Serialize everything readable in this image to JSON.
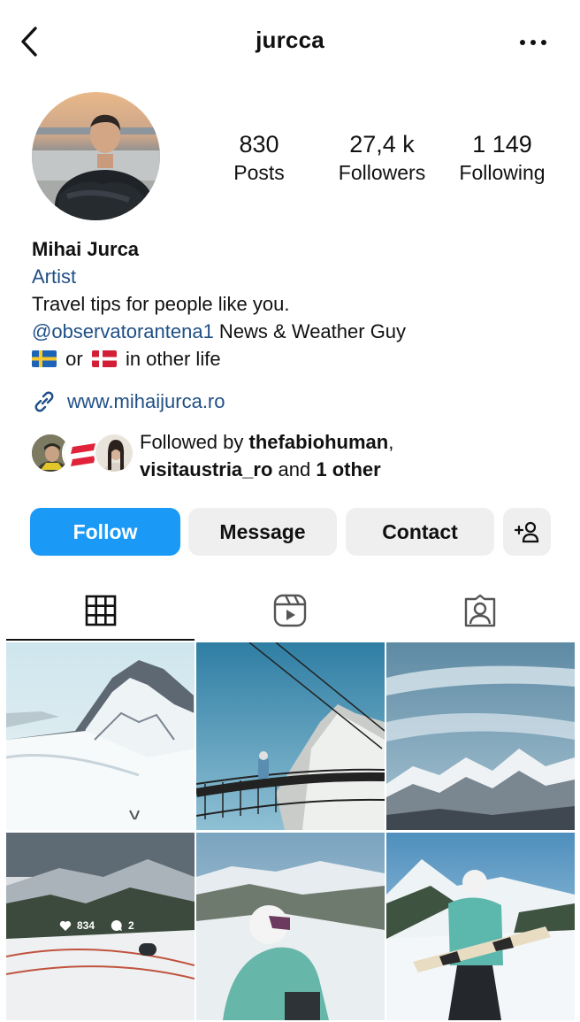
{
  "header": {
    "username": "jurcca",
    "back_icon": "chevron-left-icon",
    "more_icon": "more-horizontal-icon"
  },
  "profile": {
    "stats": [
      {
        "value": "830",
        "label": "Posts"
      },
      {
        "value": "27,4 k",
        "label": "Followers"
      },
      {
        "value": "1 149",
        "label": "Following"
      }
    ],
    "name": "Mihai Jurca",
    "category": "Artist",
    "bio_line1": "Travel tips for people like you.",
    "bio_mention": "@observatorantena1",
    "bio_line2_rest": " News & Weather Guy",
    "bio_line3_or": "or",
    "bio_line3_rest": "in other life",
    "website": "www.mihaijurca.ro"
  },
  "followed_by": {
    "prefix": "Followed by ",
    "user1": "thefabiohuman",
    "sep": ",",
    "user2": "visitaustria_ro",
    "and": " and ",
    "others": "1 other"
  },
  "actions": {
    "follow": "Follow",
    "message": "Message",
    "contact": "Contact",
    "add_user_icon": "add-person-icon"
  },
  "tabs": [
    {
      "name": "grid",
      "icon": "grid-icon",
      "active": true
    },
    {
      "name": "reels",
      "icon": "reels-icon",
      "active": false
    },
    {
      "name": "tagged",
      "icon": "tagged-person-icon",
      "active": false
    }
  ],
  "posts": [
    {
      "likes": null,
      "comments": null
    },
    {
      "likes": null,
      "comments": null
    },
    {
      "likes": null,
      "comments": null
    },
    {
      "likes": "834",
      "comments": "2"
    },
    {
      "likes": null,
      "comments": null
    },
    {
      "likes": null,
      "comments": null
    }
  ],
  "colors": {
    "accent": "#1a9af6",
    "link": "#1f4f86",
    "button_bg": "#efefef"
  }
}
